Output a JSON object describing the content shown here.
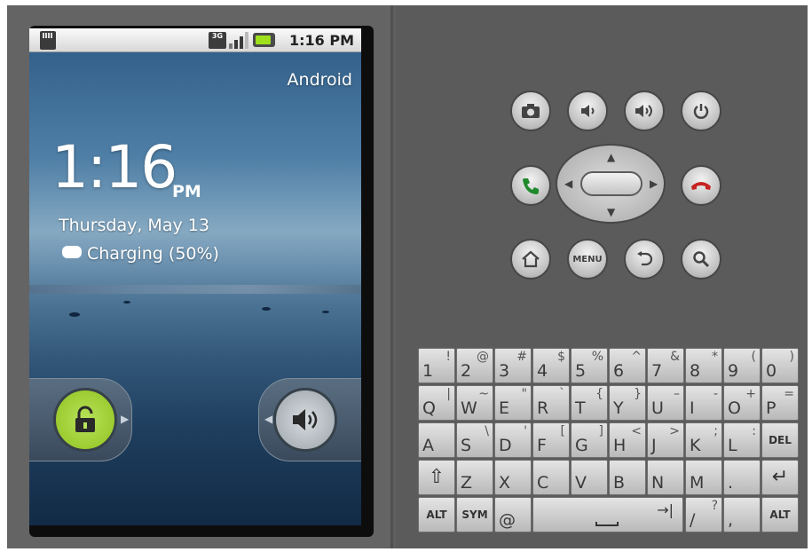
{
  "status_bar": {
    "time": "1:16 PM",
    "network": "3G",
    "battery": "charging"
  },
  "lockscreen": {
    "carrier": "Android",
    "time": "1:16",
    "ampm": "PM",
    "date": "Thursday, May 13",
    "charging_label": "Charging (50%)"
  },
  "hardware_buttons": {
    "top_row": [
      "camera-icon",
      "volume-down-icon",
      "volume-up-icon",
      "power-icon"
    ],
    "middle_row": [
      "call-icon",
      "dpad",
      "end-call-icon"
    ],
    "bottom_row": [
      "home-icon",
      "MENU",
      "back-icon",
      "search-icon"
    ],
    "menu_label": "MENU"
  },
  "keyboard": {
    "row1": [
      {
        "main": "1",
        "alt": "!"
      },
      {
        "main": "2",
        "alt": "@"
      },
      {
        "main": "3",
        "alt": "#"
      },
      {
        "main": "4",
        "alt": "$"
      },
      {
        "main": "5",
        "alt": "%"
      },
      {
        "main": "6",
        "alt": "^"
      },
      {
        "main": "7",
        "alt": "&"
      },
      {
        "main": "8",
        "alt": "*"
      },
      {
        "main": "9",
        "alt": "("
      },
      {
        "main": "0",
        "alt": ")"
      }
    ],
    "row2": [
      {
        "main": "Q",
        "alt": "|"
      },
      {
        "main": "W",
        "alt": "~"
      },
      {
        "main": "E",
        "alt": "\""
      },
      {
        "main": "R",
        "alt": "`"
      },
      {
        "main": "T",
        "alt": "{"
      },
      {
        "main": "Y",
        "alt": "}"
      },
      {
        "main": "U",
        "alt": "–"
      },
      {
        "main": "I",
        "alt": "-"
      },
      {
        "main": "O",
        "alt": "+"
      },
      {
        "main": "P",
        "alt": "="
      }
    ],
    "row3": [
      {
        "main": "A",
        "alt": ""
      },
      {
        "main": "S",
        "alt": "\\"
      },
      {
        "main": "D",
        "alt": "'"
      },
      {
        "main": "F",
        "alt": "["
      },
      {
        "main": "G",
        "alt": "]"
      },
      {
        "main": "H",
        "alt": "<"
      },
      {
        "main": "J",
        "alt": ">"
      },
      {
        "main": "K",
        "alt": ";"
      },
      {
        "main": "L",
        "alt": ":"
      },
      {
        "main": "DEL",
        "alt": ""
      }
    ],
    "row4": [
      {
        "main": "⇧",
        "alt": ""
      },
      {
        "main": "Z",
        "alt": ""
      },
      {
        "main": "X",
        "alt": ""
      },
      {
        "main": "C",
        "alt": ""
      },
      {
        "main": "V",
        "alt": ""
      },
      {
        "main": "B",
        "alt": ""
      },
      {
        "main": "N",
        "alt": ""
      },
      {
        "main": "M",
        "alt": ""
      },
      {
        "main": ".",
        "alt": ""
      },
      {
        "main": "↵",
        "alt": ""
      }
    ],
    "row5": {
      "alt_left": "ALT",
      "sym": "SYM",
      "at": "@",
      "slash": {
        "main": "/",
        "alt": "?"
      },
      "comma": {
        "main": ",",
        "alt": ""
      },
      "alt_right": "ALT"
    }
  }
}
